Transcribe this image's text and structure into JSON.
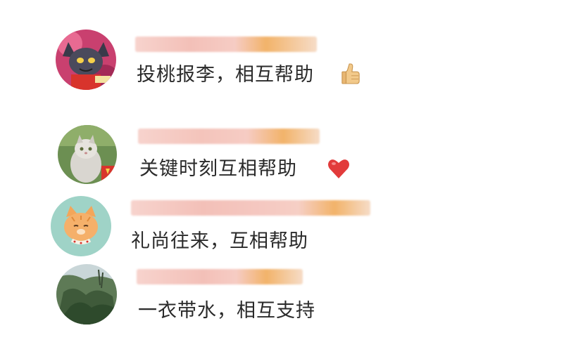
{
  "comments": [
    {
      "avatar": "cartoon-wolf-avatar",
      "text": "投桃报李，相互帮助",
      "emoji": "thumbs-up-icon"
    },
    {
      "avatar": "cat-photo-avatar",
      "text": "关键时刻互相帮助",
      "emoji": "red-heart-icon"
    },
    {
      "avatar": "cartoon-cat-avatar",
      "text": "礼尚往来，互相帮助",
      "emoji": ""
    },
    {
      "avatar": "tree-photo-avatar",
      "text": "一衣带水，相互支持",
      "emoji": ""
    }
  ],
  "colors": {
    "text": "#2a2a2a",
    "name_blur_pink": "#f4c6c0",
    "name_blur_orange": "#f2b36a",
    "cat_avatar_bg": "#9fd3c7",
    "wolf_avatar_bg": "#c9406f"
  }
}
